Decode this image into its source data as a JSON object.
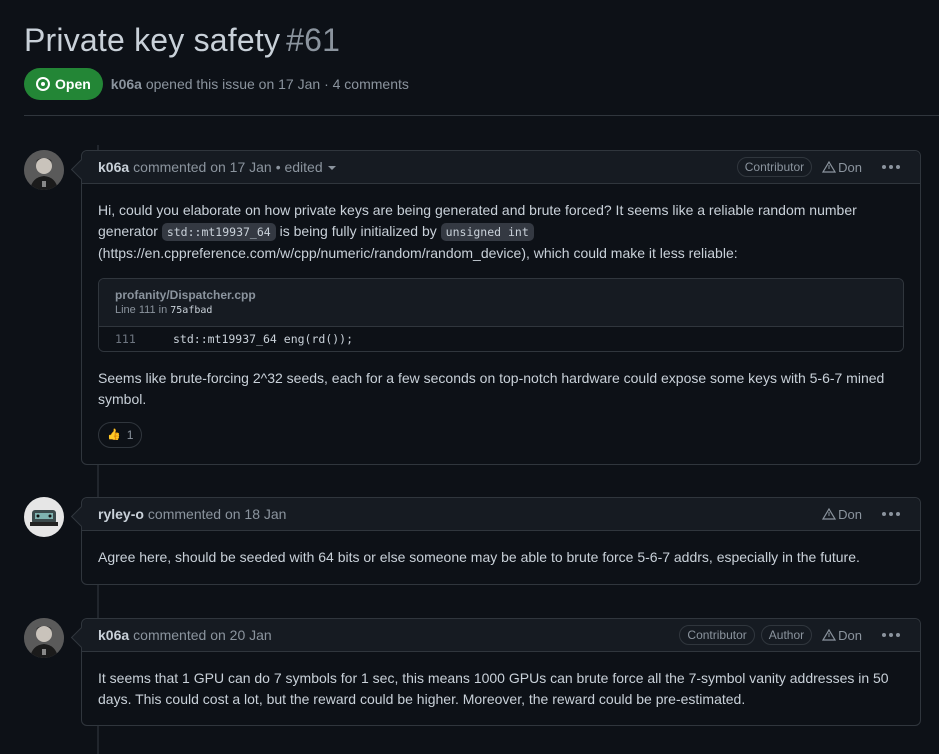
{
  "issue": {
    "title": "Private key safety",
    "number": "#61",
    "status": "Open",
    "author": "k06a",
    "meta": "opened this issue on 17 Jan · 4 comments"
  },
  "comments": [
    {
      "author": "k06a",
      "action": "commented on 17 Jan",
      "edited": "• edited",
      "labels": [
        "Contributor"
      ],
      "don": "Don",
      "body": {
        "p1_a": "Hi, could you elaborate on how private keys are being generated and brute forced? It seems like a reliable random number generator ",
        "code1": "std::mt19937_64",
        "p1_b": " is being fully initialized by ",
        "code2": "unsigned int",
        "p1_c": "(https://en.cppreference.com/w/cpp/numeric/random/random_device), which could make it less reliable:",
        "snippet_file": "profanity/Dispatcher.cpp",
        "snippet_line_prefix": "Line 111 in",
        "snippet_sha": "75afbad",
        "snippet_ln": "111",
        "snippet_code": "std::mt19937_64 eng(rd());",
        "p2": "Seems like brute-forcing 2^32 seeds, each for a few seconds on top-notch hardware could expose some keys with 5-6-7 mined symbol.",
        "reaction_icon": "👍",
        "reaction_count": "1"
      }
    },
    {
      "author": "ryley-o",
      "action": "commented on 18 Jan",
      "don": "Don",
      "body": "Agree here, should be seeded with 64 bits or else someone may be able to brute force 5-6-7 addrs, especially in the future."
    },
    {
      "author": "k06a",
      "action": "commented on 20 Jan",
      "labels": [
        "Contributor",
        "Author"
      ],
      "don": "Don",
      "body": "It seems that 1 GPU can do 7 symbols for 1 sec, this means 1000 GPUs can brute force all the 7-symbol vanity addresses in 50 days. This could cost a lot, but the reward could be higher. Moreover, the reward could be pre-estimated."
    }
  ]
}
